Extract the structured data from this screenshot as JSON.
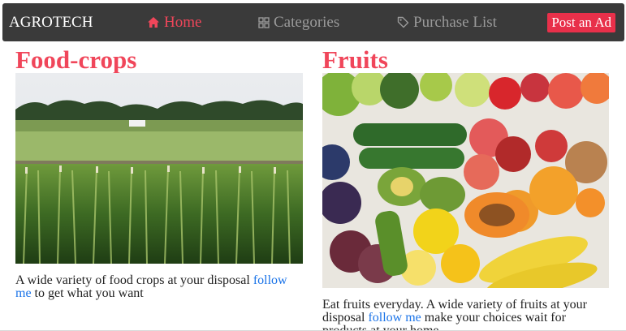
{
  "navbar": {
    "brand": "AGROTECH",
    "items": [
      {
        "label": "Home",
        "icon": "home-icon",
        "active": true
      },
      {
        "label": "Categories",
        "icon": "grid-icon",
        "active": false
      },
      {
        "label": "Purchase List",
        "icon": "tag-icon",
        "active": false
      }
    ],
    "post_label": "Post an Ad"
  },
  "cards": [
    {
      "title": "Food-crops",
      "text_before": "A wide variety of food crops at your disposal ",
      "link": "follow me",
      "text_after": " to get what you want"
    },
    {
      "title": "Fruits",
      "text_before": "Eat fruits everyday. A wide variety of fruits at your disposal ",
      "link": "follow me",
      "text_after": " make your choices wait for products at your home"
    }
  ],
  "colors": {
    "accent": "#f0465a",
    "navbar_bg": "#3a3a3a",
    "button_bg": "#e8304a",
    "link": "#1a73e8"
  }
}
